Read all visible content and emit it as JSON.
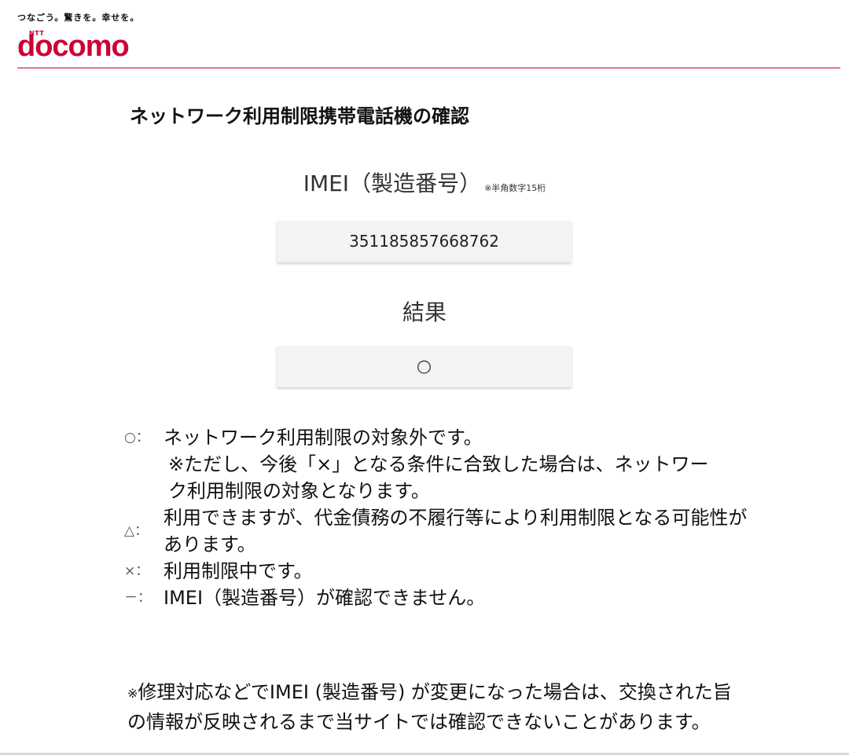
{
  "header": {
    "tagline": "つなごう。驚きを。幸せを。",
    "logo_sub": "NTT",
    "logo_text": "docomo",
    "brand_color": "#cc0033"
  },
  "main": {
    "title": "ネットワーク利用制限携帯電話機の確認",
    "imei_label": "IMEI（製造番号）",
    "imei_note": "※半角数字15桁",
    "imei_value": "351185857668762",
    "result_label": "結果",
    "result_value": "○"
  },
  "legend": [
    {
      "symbol": "○：",
      "text": "ネットワーク利用制限の対象外です。",
      "note": "※ただし、今後「×」となる条件に合致した場合は、ネットワーク利用制限の対象となります。"
    },
    {
      "symbol": "△：",
      "text": "利用できますが、代金債務の不履行等により利用制限となる可能性があります。"
    },
    {
      "symbol": "×：",
      "text": "利用制限中です。"
    },
    {
      "symbol": "－：",
      "text": "IMEI（製造番号）が確認できません。"
    }
  ],
  "footnote": {
    "mark": "※",
    "text": "修理対応などでIMEI (製造番号) が変更になった場合は、交換された旨の情報が反映されるまで当サイトでは確認できないことがあります。"
  }
}
